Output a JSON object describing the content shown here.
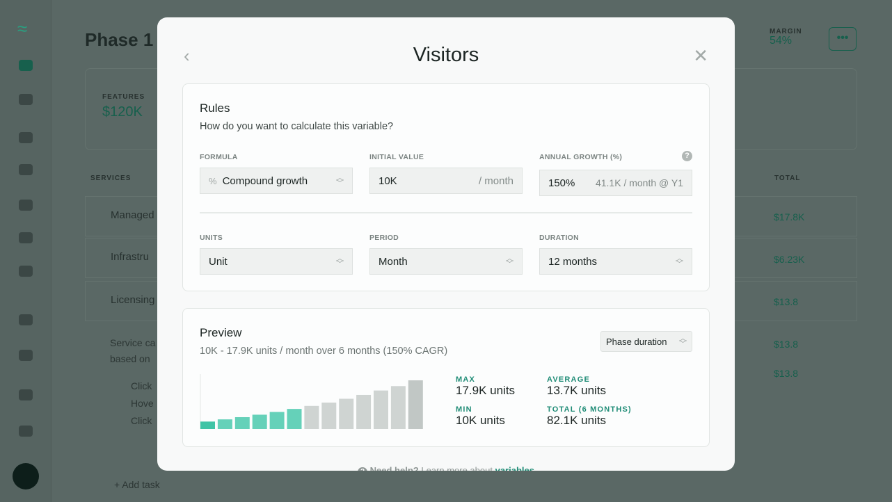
{
  "background": {
    "page_title": "Phase 1",
    "features_label": "FEATURES",
    "features_value": "$120K",
    "margin_label": "MARGIN",
    "margin_value": "54%",
    "more_label": "•••",
    "services_label": "SERVICES",
    "total_label": "TOTAL",
    "rows": [
      {
        "name": "Managed",
        "total": "$17.8K"
      },
      {
        "name": "Infrastru",
        "total": "$6.23K"
      },
      {
        "name": "Licensing",
        "total": "$13.8"
      }
    ],
    "description": [
      "Service ca",
      "based on"
    ],
    "bullets": [
      "Click",
      "Hove",
      "Click"
    ],
    "sub_totals": [
      "$13.8",
      "$13.8"
    ],
    "add_task": "+ Add task"
  },
  "modal": {
    "title": "Visitors",
    "back_icon": "chevron-left-icon",
    "close_icon": "close-icon",
    "rules": {
      "heading": "Rules",
      "subheading": "How do you want to calculate this variable?",
      "formula": {
        "label": "FORMULA",
        "icon": "percent-icon",
        "value": "Compound growth"
      },
      "initial_value": {
        "label": "INITIAL VALUE",
        "value": "10K",
        "suffix": "/ month"
      },
      "annual_growth": {
        "label": "ANNUAL GROWTH (%)",
        "value": "150%",
        "hint": "41.1K / month @ Y1"
      },
      "units": {
        "label": "UNITS",
        "value": "Unit"
      },
      "period": {
        "label": "PERIOD",
        "value": "Month"
      },
      "duration": {
        "label": "DURATION",
        "value": "12 months"
      }
    },
    "preview": {
      "heading": "Preview",
      "summary": "10K - 17.9K units / month over 6 months (150% CAGR)",
      "range_select": "Phase duration",
      "stats": {
        "max_label": "MAX",
        "max_value": "17.9K units",
        "average_label": "AVERAGE",
        "average_value": "13.7K units",
        "min_label": "MIN",
        "min_value": "10K units",
        "total_label": "TOTAL (6 MONTHS)",
        "total_value": "82.1K units"
      }
    },
    "footer": {
      "prefix": "Need help?",
      "text": " Learn more about ",
      "link": "variables"
    }
  },
  "chart_data": {
    "type": "bar",
    "values": [
      10.0,
      10.8,
      11.6,
      12.5,
      13.5,
      14.6,
      15.7,
      16.9,
      18.3,
      19.7,
      21.3,
      22.9,
      25.0
    ],
    "highlighted_count": 6,
    "colors": {
      "highlight": "#65d1b9",
      "first": "#40c4a6",
      "rest": "#cfd4d2",
      "last": "#c1c7c5"
    }
  }
}
